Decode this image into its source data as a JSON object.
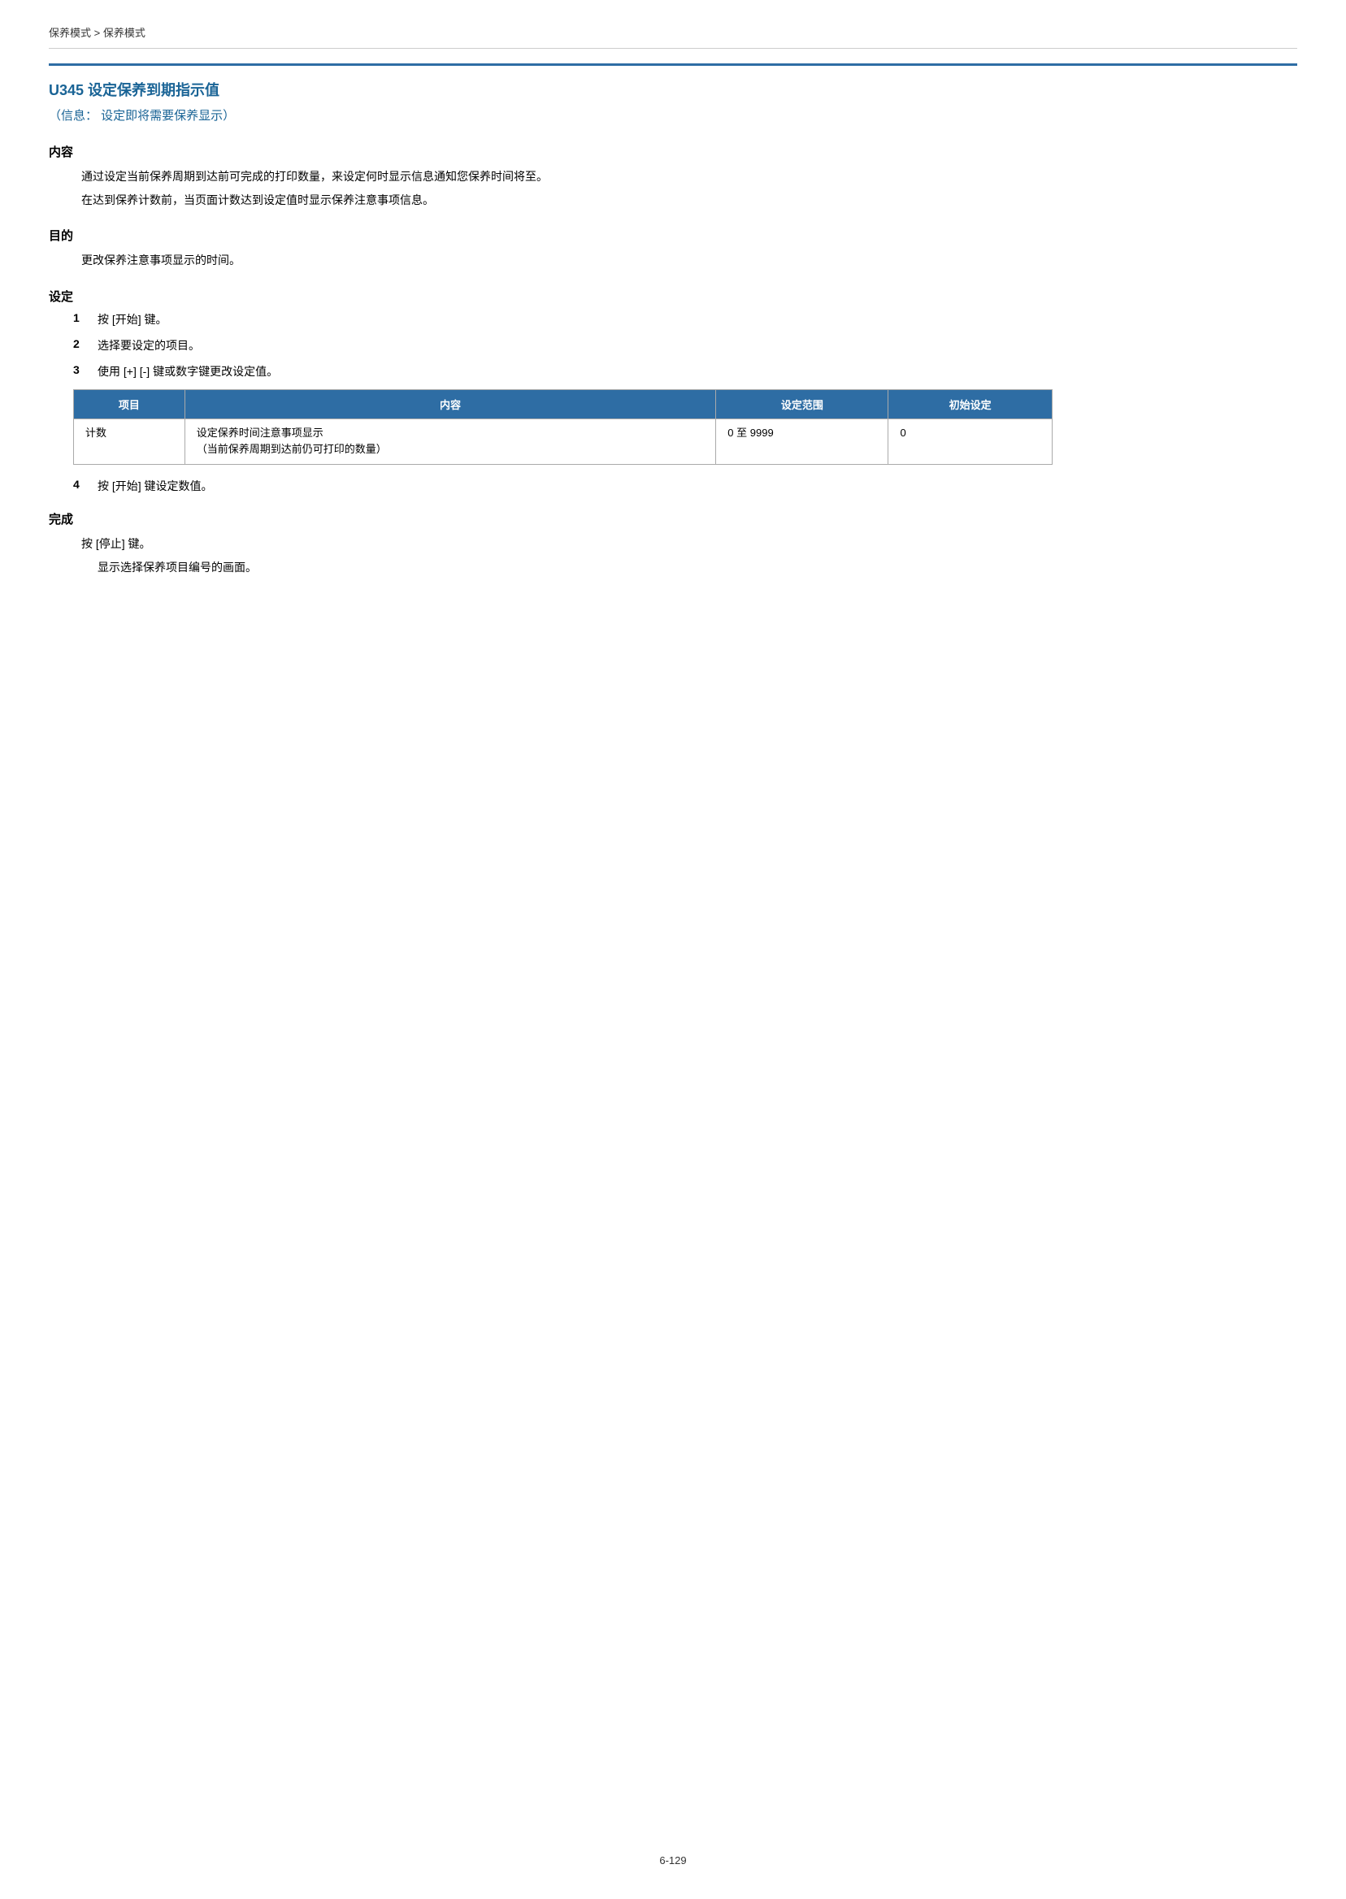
{
  "breadcrumb": {
    "text": "保养模式 > 保养模式"
  },
  "page": {
    "title": "U345  设定保养到期指示值",
    "subtitle": "（信息：  设定即将需要保养显示）"
  },
  "sections": {
    "content_title": "内容",
    "content_lines": [
      "通过设定当前保养周期到达前可完成的打印数量，来设定何时显示信息通知您保养时间将至。",
      "在达到保养计数前，当页面计数达到设定值时显示保养注意事项信息。"
    ],
    "purpose_title": "目的",
    "purpose_lines": [
      "更改保养注意事项显示的时间。"
    ],
    "setting_title": "设定",
    "steps": [
      {
        "number": "1",
        "text": "按 [开始] 键。"
      },
      {
        "number": "2",
        "text": "选择要设定的项目。"
      },
      {
        "number": "3",
        "text": "使用 [+] [-] 键或数字键更改设定值。"
      }
    ],
    "table": {
      "headers": [
        "项目",
        "内容",
        "设定范围",
        "初始设定"
      ],
      "rows": [
        {
          "col1": "计数",
          "col2_line1": "设定保养时间注意事项显示",
          "col2_line2": "（当前保养周期到达前仍可打印的数量）",
          "col3": "0 至 9999",
          "col4": "0"
        }
      ]
    },
    "step4": {
      "number": "4",
      "text": "按 [开始] 键设定数值。"
    },
    "complete_title": "完成",
    "complete_lines": [
      "按 [停止] 键。",
      "显示选择保养项目编号的画面。"
    ]
  },
  "footer": {
    "page_number": "6-129"
  }
}
